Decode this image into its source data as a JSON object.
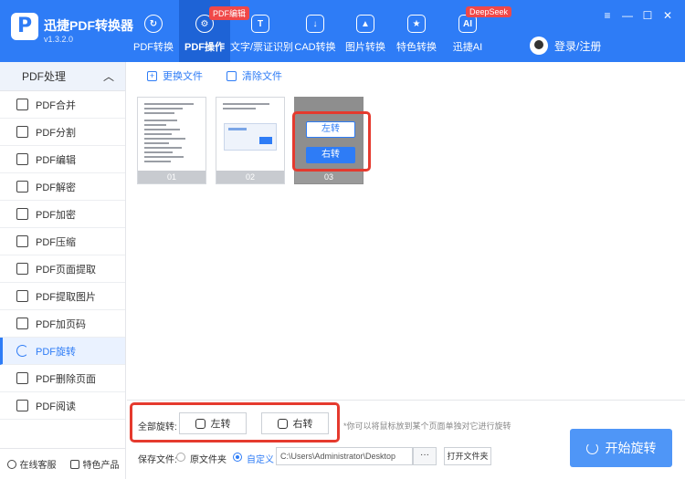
{
  "app": {
    "title": "迅捷PDF转换器",
    "version": "v1.3.2.0",
    "logo": "P"
  },
  "nav": [
    {
      "label": "PDF转换",
      "icon": "refresh-icon",
      "glyph": "↻",
      "active": false,
      "badge": ""
    },
    {
      "label": "PDF操作",
      "icon": "gear-icon",
      "glyph": "⚙",
      "active": true,
      "badge": "PDF编辑"
    },
    {
      "label": "文字/票证识别",
      "icon": "scan-icon",
      "glyph": "T",
      "active": false,
      "badge": ""
    },
    {
      "label": "CAD转换",
      "icon": "cad-icon",
      "glyph": "↓",
      "active": false,
      "badge": ""
    },
    {
      "label": "图片转换",
      "icon": "image-icon",
      "glyph": "▲",
      "active": false,
      "badge": ""
    },
    {
      "label": "特色转换",
      "icon": "star-icon",
      "glyph": "★",
      "active": false,
      "badge": ""
    },
    {
      "label": "迅捷AI",
      "icon": "ai-icon",
      "glyph": "AI",
      "active": false,
      "badge": "DeepSeek"
    }
  ],
  "user": {
    "label": "登录/注册"
  },
  "window_controls": {
    "menu": "≡",
    "minimize": "—",
    "maximize": "☐",
    "close": "✕"
  },
  "sidebar": {
    "title": "PDF处理",
    "items": [
      {
        "label": "PDF合并",
        "active": false
      },
      {
        "label": "PDF分割",
        "active": false
      },
      {
        "label": "PDF编辑",
        "active": false
      },
      {
        "label": "PDF解密",
        "active": false
      },
      {
        "label": "PDF加密",
        "active": false
      },
      {
        "label": "PDF压缩",
        "active": false
      },
      {
        "label": "PDF页面提取",
        "active": false
      },
      {
        "label": "PDF提取图片",
        "active": false
      },
      {
        "label": "PDF加页码",
        "active": false
      },
      {
        "label": "PDF旋转",
        "active": true
      },
      {
        "label": "PDF删除页面",
        "active": false
      },
      {
        "label": "PDF阅读",
        "active": false
      }
    ],
    "footer": {
      "service": "在线客服",
      "products": "特色产品"
    }
  },
  "toolbar": {
    "replace_file": "更换文件",
    "clear_file": "清除文件"
  },
  "thumbnails": [
    {
      "number": "01"
    },
    {
      "number": "02"
    },
    {
      "number": "03"
    }
  ],
  "hover_controls": {
    "rotate_left": "左转",
    "rotate_right": "右转"
  },
  "bottom": {
    "all_rotate_label": "全部旋转:",
    "rotate_left": "左转",
    "rotate_right": "右转",
    "hint": "*你可以将鼠标放到某个页面单独对它进行旋转",
    "save_label": "保存文件:",
    "option_original": "原文件夹",
    "option_custom": "自定义",
    "path": "C:\\Users\\Administrator\\Desktop",
    "more": "···",
    "open_folder": "打开文件夹",
    "start": "开始旋转"
  },
  "colors": {
    "brand": "#2e7cf6",
    "highlight": "#e53a2e",
    "badge": "#f04848"
  }
}
